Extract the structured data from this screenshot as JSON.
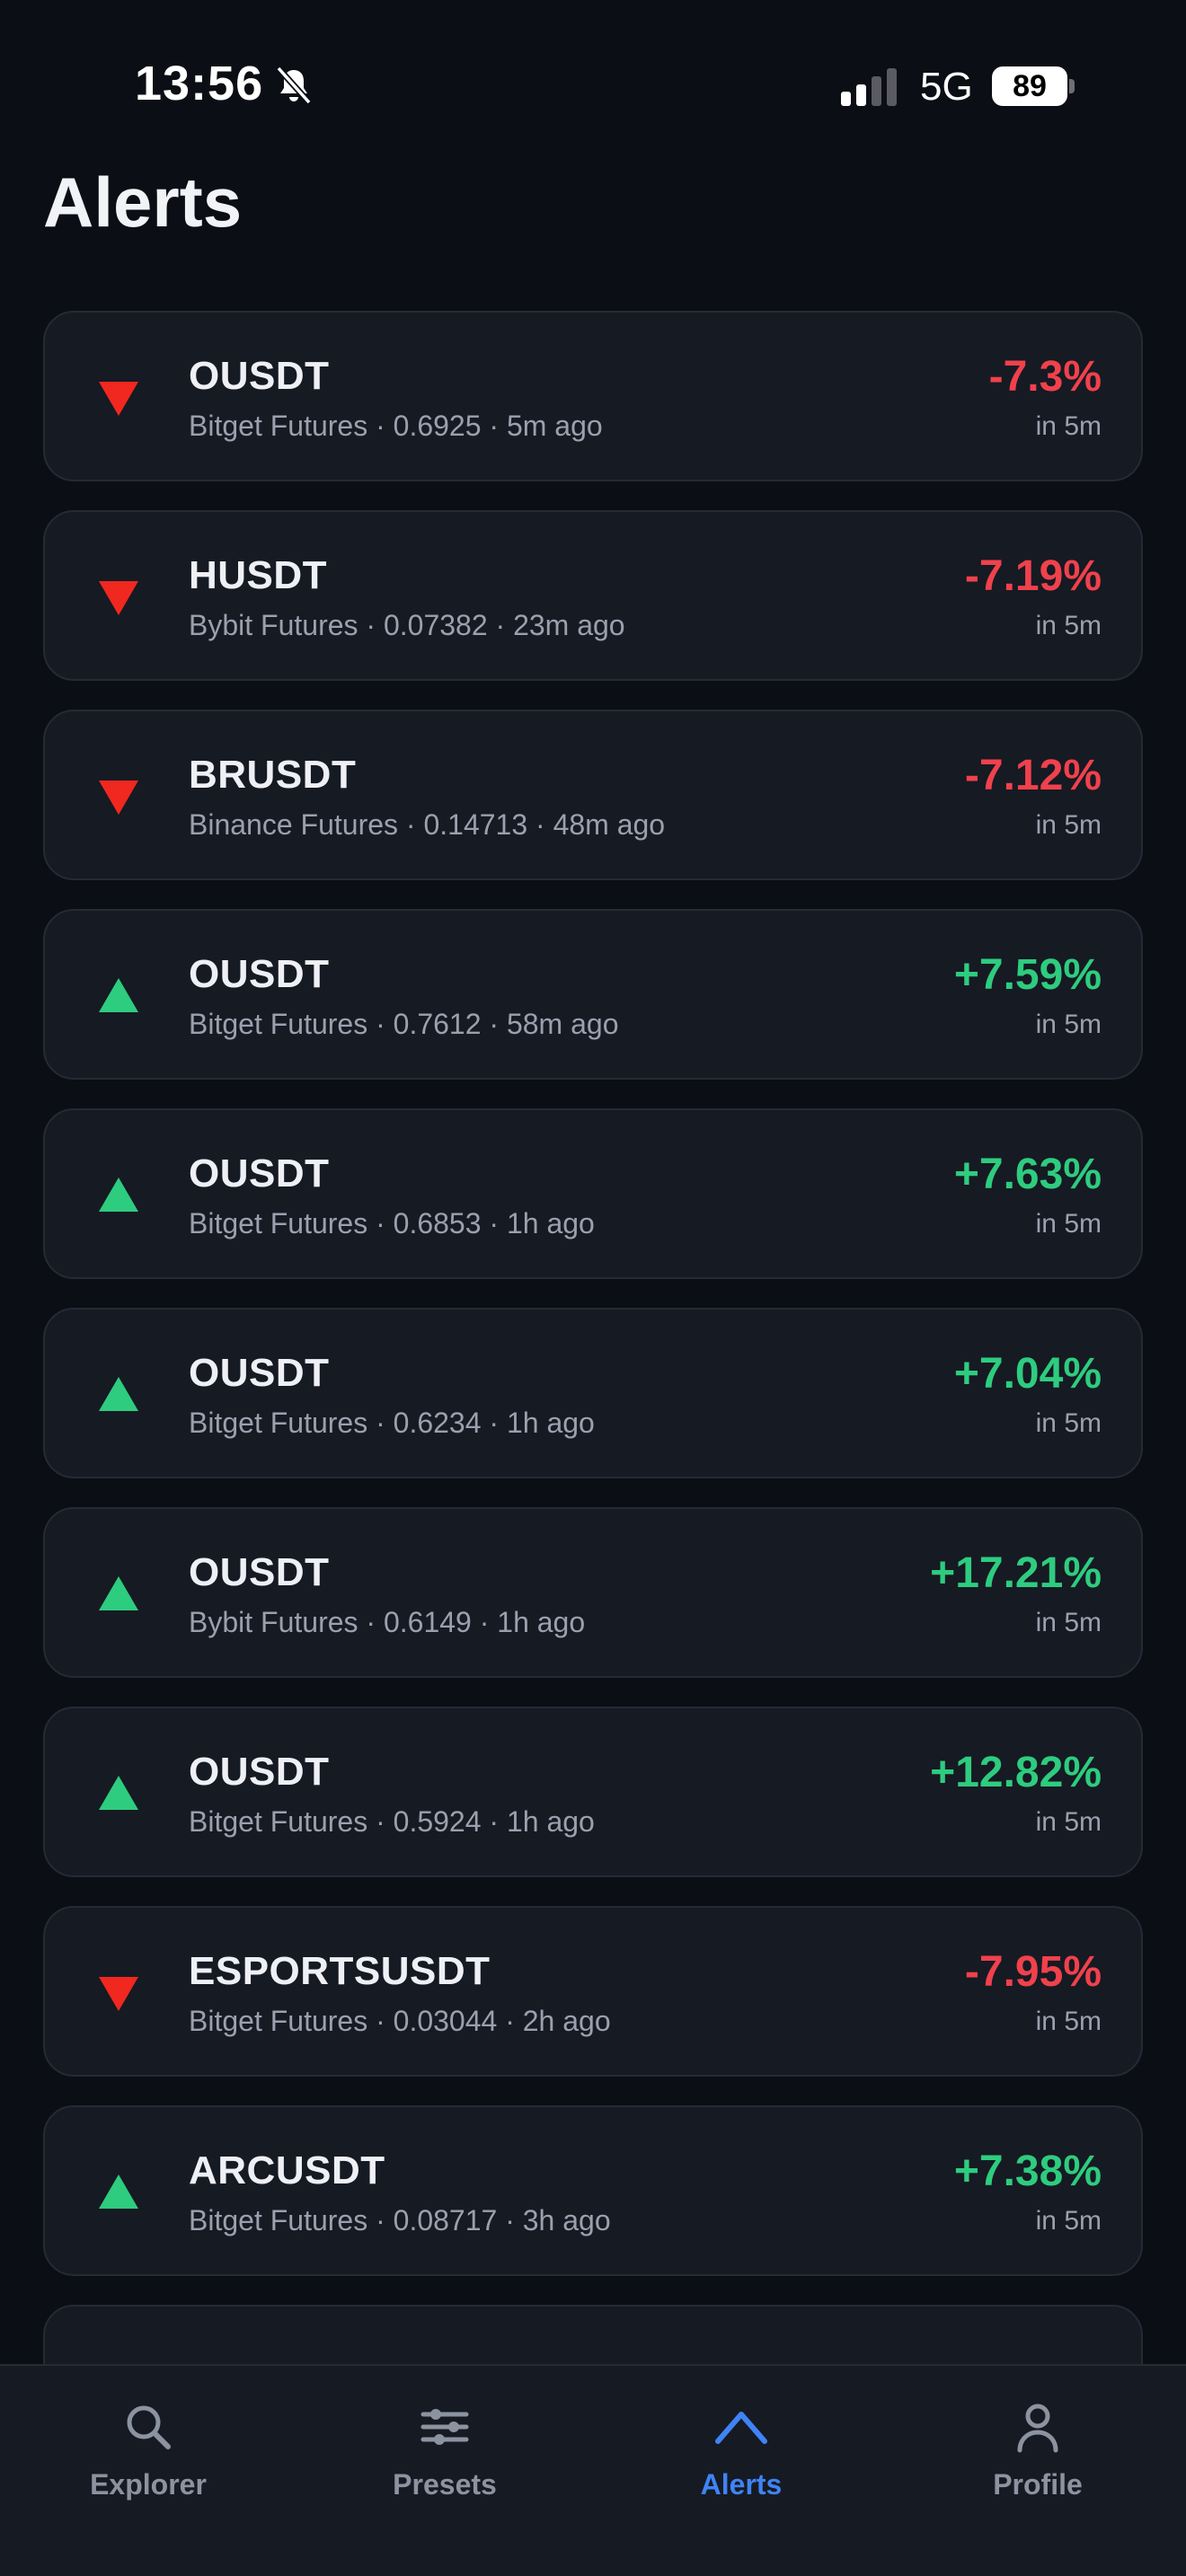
{
  "status_bar": {
    "time": "13:56",
    "network": "5G",
    "battery": "89"
  },
  "page": {
    "title": "Alerts"
  },
  "alerts": [
    {
      "symbol": "OUSDT",
      "meta": "Bitget Futures · 0.6925 · 5m ago",
      "change": "-7.3%",
      "window": "in 5m",
      "direction": "down"
    },
    {
      "symbol": "HUSDT",
      "meta": "Bybit Futures · 0.07382 · 23m ago",
      "change": "-7.19%",
      "window": "in 5m",
      "direction": "down"
    },
    {
      "symbol": "BRUSDT",
      "meta": "Binance Futures · 0.14713 · 48m ago",
      "change": "-7.12%",
      "window": "in 5m",
      "direction": "down"
    },
    {
      "symbol": "OUSDT",
      "meta": "Bitget Futures · 0.7612 · 58m ago",
      "change": "+7.59%",
      "window": "in 5m",
      "direction": "up"
    },
    {
      "symbol": "OUSDT",
      "meta": "Bitget Futures · 0.6853 · 1h ago",
      "change": "+7.63%",
      "window": "in 5m",
      "direction": "up"
    },
    {
      "symbol": "OUSDT",
      "meta": "Bitget Futures · 0.6234 · 1h ago",
      "change": "+7.04%",
      "window": "in 5m",
      "direction": "up"
    },
    {
      "symbol": "OUSDT",
      "meta": "Bybit Futures · 0.6149 · 1h ago",
      "change": "+17.21%",
      "window": "in 5m",
      "direction": "up"
    },
    {
      "symbol": "OUSDT",
      "meta": "Bitget Futures · 0.5924 · 1h ago",
      "change": "+12.82%",
      "window": "in 5m",
      "direction": "up"
    },
    {
      "symbol": "ESPORTSUSDT",
      "meta": "Bitget Futures · 0.03044 · 2h ago",
      "change": "-7.95%",
      "window": "in 5m",
      "direction": "down"
    },
    {
      "symbol": "ARCUSDT",
      "meta": "Bitget Futures · 0.08717 · 3h ago",
      "change": "+7.38%",
      "window": "in 5m",
      "direction": "up"
    }
  ],
  "tab_bar": {
    "tabs": [
      {
        "label": "Explorer",
        "icon": "search-icon"
      },
      {
        "label": "Presets",
        "icon": "sliders-icon"
      },
      {
        "label": "Alerts",
        "icon": "chevron-up-icon"
      },
      {
        "label": "Profile",
        "icon": "person-icon"
      }
    ],
    "active": "Alerts"
  },
  "colors": {
    "background": "#0b0e14",
    "card": "#161a23",
    "down": "#f0414c",
    "up": "#2ecc7f",
    "accent": "#3f83f5",
    "muted": "#9aa1ae"
  }
}
